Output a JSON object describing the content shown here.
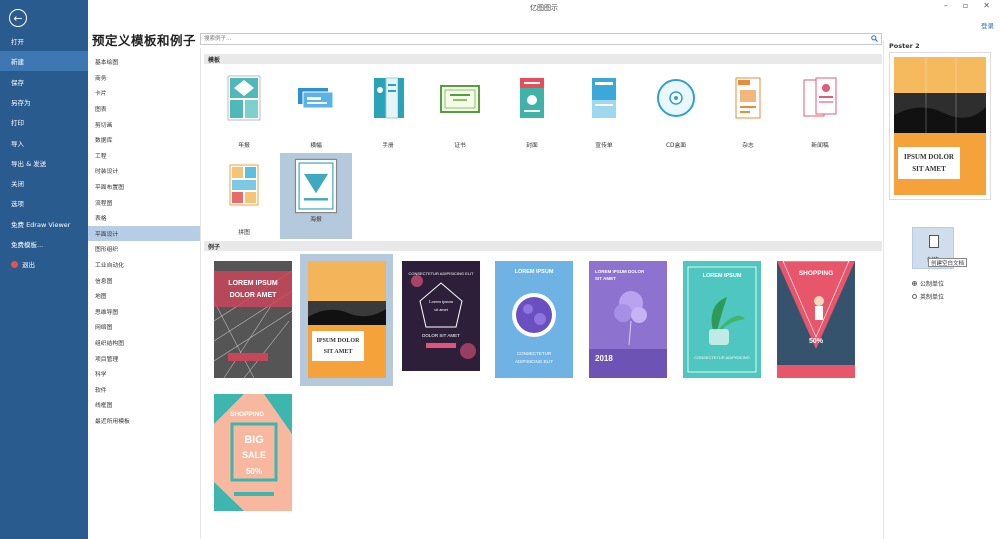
{
  "window": {
    "title": "亿图图示",
    "minimize": "–",
    "restore": "▫",
    "close": "✕",
    "login": "登录"
  },
  "nav": {
    "back_icon": "arrow-left",
    "items": [
      {
        "label": "打开"
      },
      {
        "label": "新建",
        "active": true
      },
      {
        "label": "保存"
      },
      {
        "label": "另存为"
      },
      {
        "label": "打印"
      },
      {
        "label": "导入"
      },
      {
        "label": "导出 & 发送"
      },
      {
        "label": "关闭"
      },
      {
        "label": "选项"
      },
      {
        "label": "免费 Edraw Viewer"
      },
      {
        "label": "免费模板..."
      },
      {
        "label": "退出"
      }
    ]
  },
  "page_title": "预定义模板和例子",
  "categories": [
    "基本绘图",
    "商务",
    "卡片",
    "图表",
    "剪切画",
    "数据库",
    "工程",
    "时装设计",
    "平面布置图",
    "流程图",
    "表格",
    "平面设计",
    "图形组织",
    "工业自动化",
    "信息图",
    "地图",
    "思维导图",
    "网络图",
    "组织结构图",
    "项目管理",
    "科学",
    "软件",
    "线框图",
    "最近所用模板"
  ],
  "active_category_index": 11,
  "search": {
    "placeholder": "搜索例子..."
  },
  "templates_header": "模板",
  "templates": [
    {
      "label": "年报"
    },
    {
      "label": "横幅"
    },
    {
      "label": "手册"
    },
    {
      "label": "证书"
    },
    {
      "label": "封面"
    },
    {
      "label": "宣传单"
    },
    {
      "label": "CD盒面"
    },
    {
      "label": "杂志"
    },
    {
      "label": "新闻稿"
    },
    {
      "label": "拼图"
    },
    {
      "label": "海报",
      "active": true
    }
  ],
  "examples_header": "例子",
  "examples": [
    {
      "lines": [
        "LOREM IPSUM",
        "DOLOR AMET"
      ]
    },
    {
      "lines": [
        "IPSUM DOLOR",
        "SIT AMET"
      ],
      "active": true
    },
    {
      "lines": [
        "CONSECTETUR ADIPISICING ELIT",
        "Lorem ipsum",
        "sit amet",
        "DOLOR SIT AMET"
      ]
    },
    {
      "lines": [
        "LOREM IPSUM",
        "CONSECTETUR",
        "ADIPISICING ELIT"
      ]
    },
    {
      "lines": [
        "LOREM IPSUM DOLOR",
        "SIT AMET",
        "2018"
      ]
    },
    {
      "lines": [
        "LOREM IPSUM",
        "CONSECTETUR ADIPISICING"
      ]
    },
    {
      "lines": [
        "SHOPPING",
        "50%"
      ]
    },
    {
      "lines": [
        "SHOPPING",
        "BIG",
        "SALE",
        "50%"
      ]
    }
  ],
  "preview": {
    "title": "Poster 2",
    "lines": [
      "IPSUM DOLOR",
      "SIT AMET"
    ]
  },
  "create": {
    "label": "创建",
    "tooltip": "创建空白文档"
  },
  "units": [
    {
      "label": "公制单位",
      "checked": true
    },
    {
      "label": "英制单位",
      "checked": false
    }
  ],
  "colors": {
    "nav_bg": "#2a5b8f",
    "nav_active": "#3d78b3",
    "selected": "#b5c9dd",
    "link": "#2f6fb6"
  }
}
